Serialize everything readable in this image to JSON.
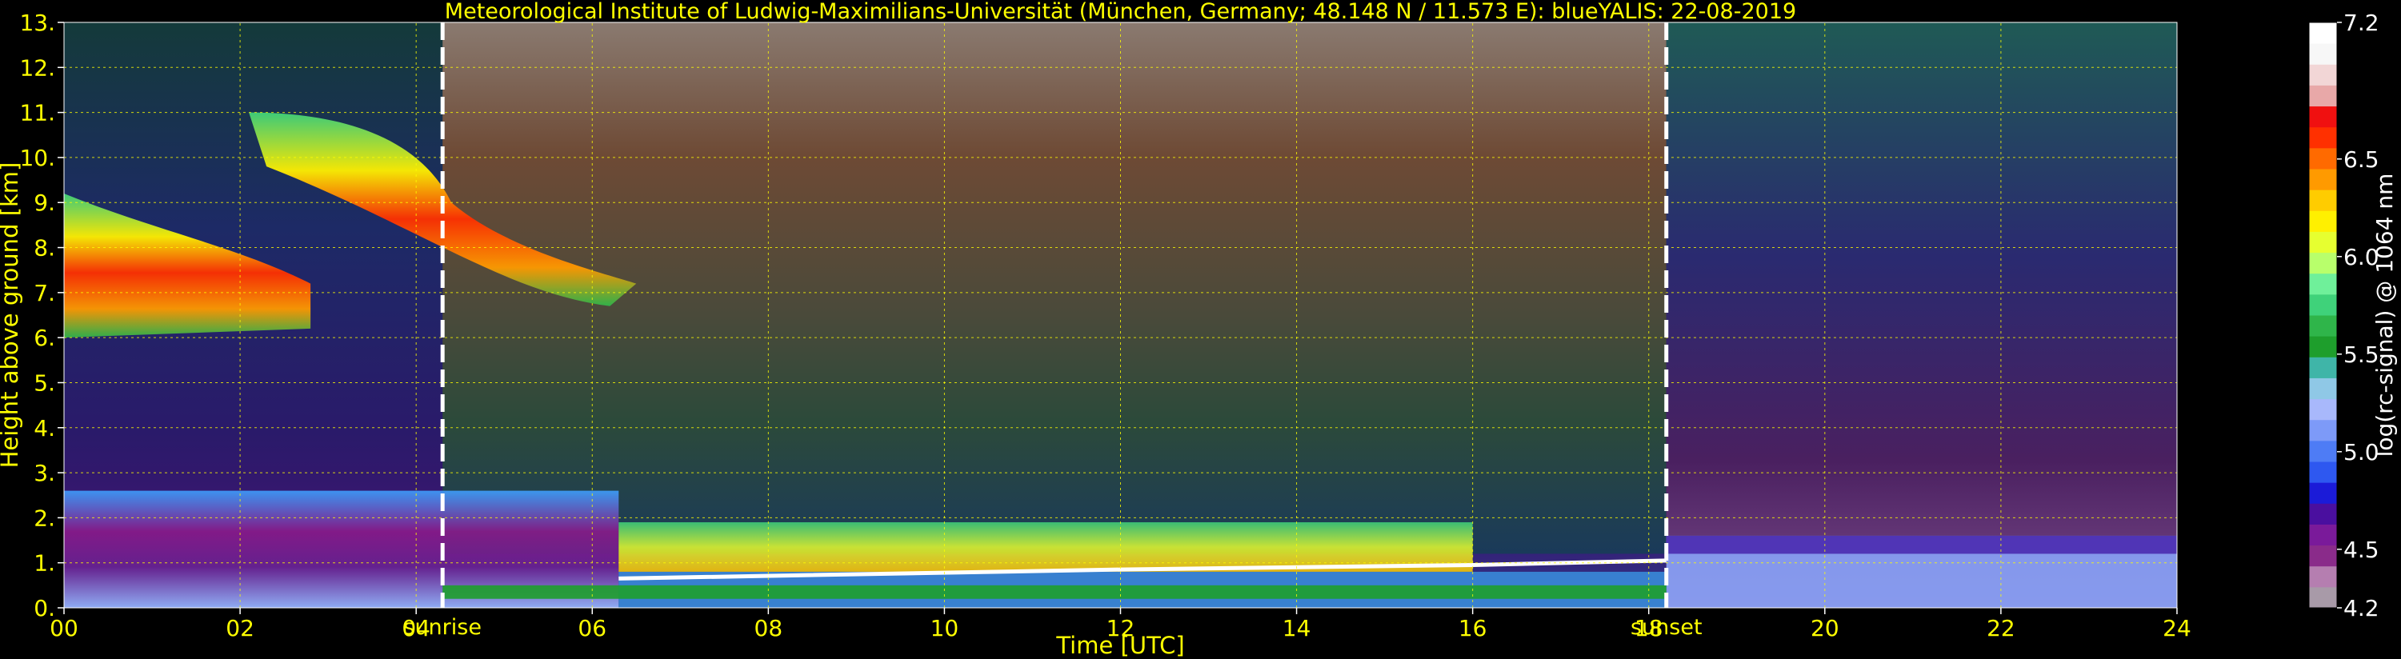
{
  "chart_data": {
    "type": "heatmap",
    "title": "Meteorological Institute of Ludwig-Maximilians-Universität (München, Germany; 48.148 N / 11.573 E):    blueYALIS: 22-08-2019",
    "xlabel": "Time [UTC]",
    "ylabel": "Height above ground [km]",
    "xlim": [
      0,
      24
    ],
    "ylim": [
      0,
      13
    ],
    "xticks": [
      "00",
      "02",
      "04",
      "06",
      "08",
      "10",
      "12",
      "14",
      "16",
      "18",
      "20",
      "22",
      "24"
    ],
    "yticks": [
      "0.",
      "1.",
      "2.",
      "3.",
      "4.",
      "5.",
      "6.",
      "7.",
      "8.",
      "9.",
      "10.",
      "11.",
      "12.",
      "13."
    ],
    "grid": true,
    "annotations": [
      {
        "text": "sunrise",
        "x": 4.3
      },
      {
        "text": "sunset",
        "x": 18.2
      }
    ],
    "colorbar": {
      "label": "log(rc-signal) @ 1064 nm",
      "range": [
        4.2,
        7.2
      ],
      "ticks": [
        "7.2",
        "6.5",
        "6.0",
        "5.5",
        "5.0",
        "4.5",
        "4.2"
      ],
      "tick_values": [
        7.2,
        6.5,
        6.0,
        5.5,
        5.0,
        4.5,
        4.2
      ],
      "colors": [
        "#a89aa8",
        "#b57eb0",
        "#8a2b8a",
        "#7a1a9a",
        "#4a0f9f",
        "#1b1bd8",
        "#2e58f0",
        "#4e7cf5",
        "#7d9af8",
        "#a8b8fb",
        "#8fc8e6",
        "#3fb5a8",
        "#1e9e2c",
        "#2fb54a",
        "#3fd27a",
        "#6ff09a",
        "#b8ff6b",
        "#e6ff30",
        "#fff000",
        "#ffcc00",
        "#ff9a00",
        "#ff6a00",
        "#ff3000",
        "#f01010",
        "#e8a8a8",
        "#f2d6d6",
        "#f7f7f7",
        "#ffffff"
      ]
    }
  }
}
